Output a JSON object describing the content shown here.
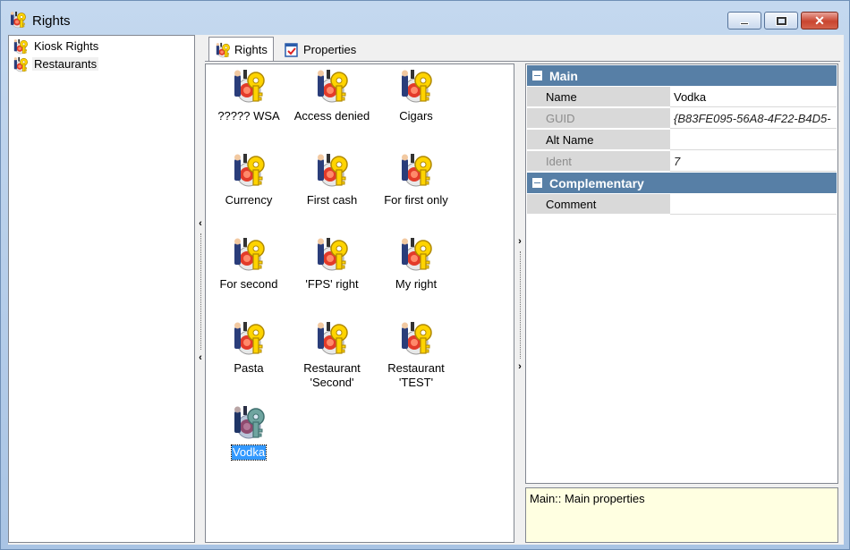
{
  "window": {
    "title": "Rights",
    "title_icon": "rights-icon"
  },
  "tree": {
    "items": [
      {
        "label": "Kiosk Rights",
        "icon": "folder-rights-icon",
        "selected": false
      },
      {
        "label": "Restaurants",
        "icon": "folder-rights-icon",
        "selected": true
      }
    ]
  },
  "tabs": [
    {
      "label": "Rights",
      "icon": "rights-icon",
      "active": true
    },
    {
      "label": "Properties",
      "icon": "properties-icon",
      "active": false
    }
  ],
  "rights": {
    "items": [
      {
        "label": "????? WSA"
      },
      {
        "label": "Access denied"
      },
      {
        "label": "Cigars"
      },
      {
        "label": "Currency"
      },
      {
        "label": "First cash"
      },
      {
        "label": "For first only"
      },
      {
        "label": "For second"
      },
      {
        "label": "'FPS' right"
      },
      {
        "label": "My right"
      },
      {
        "label": "Pasta"
      },
      {
        "label": "Restaurant\n'Second'"
      },
      {
        "label": "Restaurant\n'TEST'"
      },
      {
        "label": "Vodka"
      }
    ],
    "selected_index": 12
  },
  "properties": {
    "main": {
      "title": "Main",
      "rows": [
        {
          "key": "Name",
          "value": "Vodka"
        },
        {
          "key": "GUID",
          "value": "{B83FE095-56A8-4F22-B4D5-"
        },
        {
          "key": "Alt Name",
          "value": ""
        },
        {
          "key": "Ident",
          "value": "7"
        }
      ]
    },
    "complementary": {
      "title": "Complementary",
      "rows": [
        {
          "key": "Comment",
          "value": ""
        }
      ]
    }
  },
  "help": {
    "text": "Main:: Main properties"
  },
  "colors": {
    "category_header": "#577fa6",
    "selection": "#3399ff",
    "help_bg": "#ffffe1"
  }
}
